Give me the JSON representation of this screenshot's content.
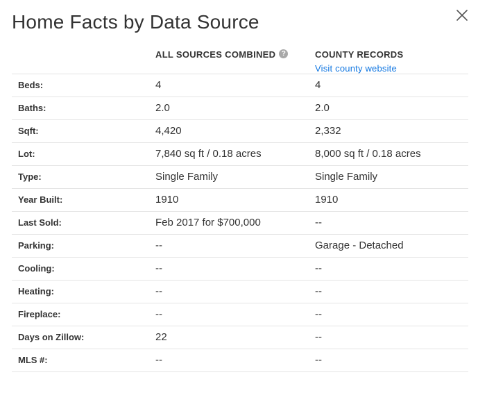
{
  "modal": {
    "title": "Home Facts by Data Source",
    "close_icon": "close-x-icon"
  },
  "columns": {
    "label": "",
    "combined": {
      "header": "ALL SOURCES COMBINED",
      "help_icon": "question-mark-icon",
      "help_glyph": "?"
    },
    "county": {
      "header": "COUNTY RECORDS",
      "link_text": "Visit county website"
    }
  },
  "rows": [
    {
      "label": "Beds:",
      "combined": "4",
      "county": "4"
    },
    {
      "label": "Baths:",
      "combined": "2.0",
      "county": "2.0"
    },
    {
      "label": "Sqft:",
      "combined": "4,420",
      "county": "2,332"
    },
    {
      "label": "Lot:",
      "combined": "7,840 sq ft / 0.18 acres",
      "county": "8,000 sq ft / 0.18 acres"
    },
    {
      "label": "Type:",
      "combined": "Single Family",
      "county": "Single Family"
    },
    {
      "label": "Year Built:",
      "combined": "1910",
      "county": "1910"
    },
    {
      "label": "Last Sold:",
      "combined": "Feb 2017 for $700,000",
      "county": "--"
    },
    {
      "label": "Parking:",
      "combined": "--",
      "county": "Garage - Detached"
    },
    {
      "label": "Cooling:",
      "combined": "--",
      "county": "--"
    },
    {
      "label": "Heating:",
      "combined": "--",
      "county": "--"
    },
    {
      "label": "Fireplace:",
      "combined": "--",
      "county": "--"
    },
    {
      "label": "Days on Zillow:",
      "combined": "22",
      "county": "--"
    },
    {
      "label": "MLS #:",
      "combined": "--",
      "county": "--"
    }
  ],
  "colors": {
    "text": "#333333",
    "link": "#1277e1",
    "divider": "#e4e4e4",
    "help_icon_bg": "#a8a8a8"
  }
}
